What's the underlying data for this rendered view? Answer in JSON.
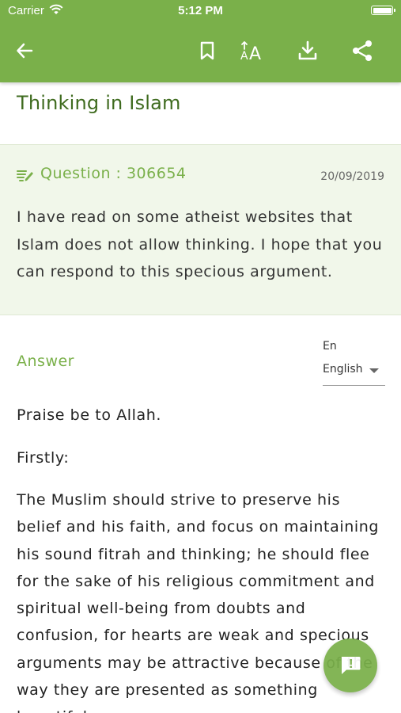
{
  "status_bar": {
    "carrier": "Carrier",
    "time": "5:12 PM"
  },
  "toolbar": {
    "icons": [
      "back-arrow-icon",
      "bookmark-icon",
      "font-size-icon",
      "download-icon",
      "share-icon"
    ],
    "accent_color": "#7ab04a"
  },
  "page": {
    "title": "Thinking in Islam"
  },
  "question": {
    "label": "Question : 306654",
    "date": "20/09/2019",
    "text": "I have read on some atheist websites that Islam does not allow thinking. I hope that you can respond to this specious argument."
  },
  "answer": {
    "label": "Answer",
    "language_code": "En",
    "language_selected": "English",
    "paragraphs": [
      "Praise be to Allah.",
      "Firstly:",
      "The Muslim should strive to preserve his belief and his faith, and focus on maintaining his sound fitrah and thinking; he should flee for the sake of his religious commitment and spiritual well-being from doubts and confusion, for hearts are weak and specious arguments may be attractive because of the way they are presented as something beautiful"
    ]
  },
  "fab": {
    "icon": "chat-exclamation-icon"
  }
}
